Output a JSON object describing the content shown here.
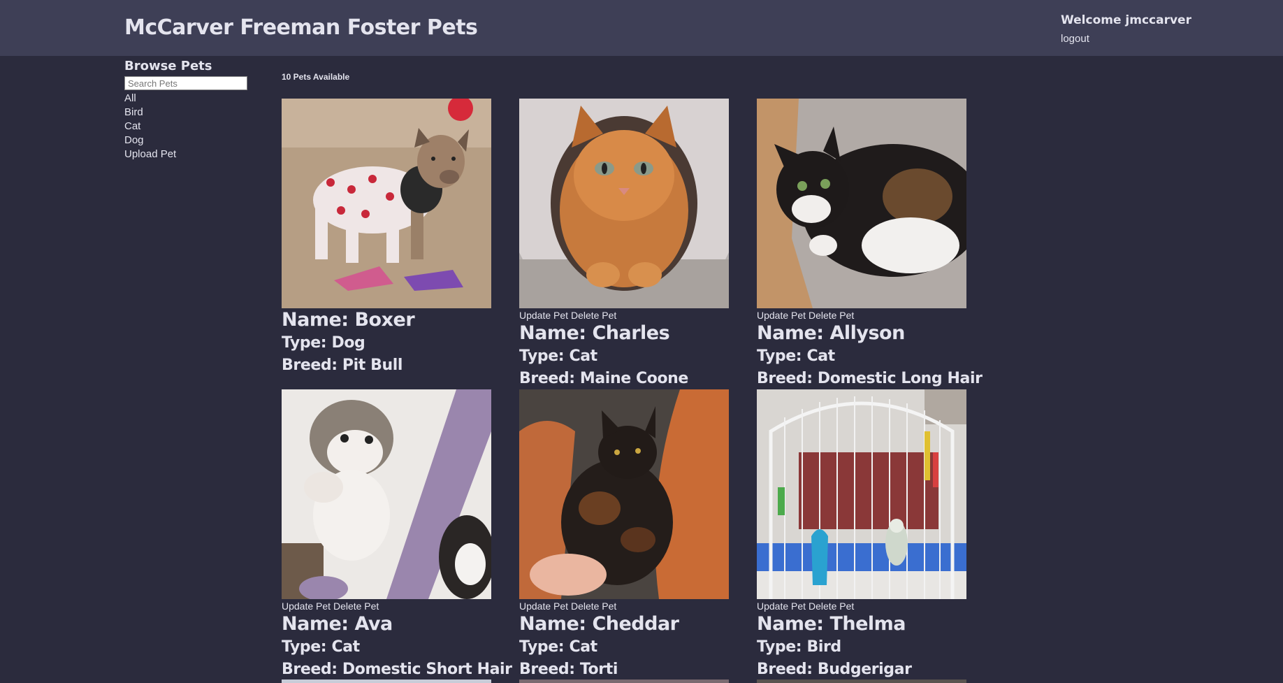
{
  "header": {
    "title": "McCarver Freeman Foster Pets",
    "welcome": "Welcome jmccarver",
    "logout": "logout"
  },
  "sidebar": {
    "heading": "Browse Pets",
    "search_placeholder": "Search Pets",
    "links": [
      "All",
      "Bird",
      "Cat",
      "Dog",
      "Upload Pet"
    ]
  },
  "main": {
    "count_text": "10 Pets Available",
    "update_label": "Update Pet",
    "delete_label": "Delete Pet",
    "pets": [
      {
        "name": "Name: Boxer",
        "type": "Type: Dog",
        "breed": "Breed: Pit Bull",
        "photo": "dog-photo",
        "show_actions": false
      },
      {
        "name": "Name: Charles",
        "type": "Type: Cat",
        "breed": "Breed: Maine Coone",
        "photo": "orange-cat-photo",
        "show_actions": true
      },
      {
        "name": "Name: Allyson",
        "type": "Type: Cat",
        "breed": "Breed: Domestic Long Hair",
        "photo": "calico-cat-photo",
        "show_actions": true
      },
      {
        "name": "Name: Ava",
        "type": "Type: Cat",
        "breed": "Breed: Domestic Short Hair",
        "photo": "kitten-photo",
        "show_actions": true
      },
      {
        "name": "Name: Cheddar",
        "type": "Type: Cat",
        "breed": "Breed: Torti",
        "photo": "tortoiseshell-cat-photo",
        "show_actions": true
      },
      {
        "name": "Name: Thelma",
        "type": "Type: Bird",
        "breed": "Breed: Budgerigar",
        "photo": "budgie-cage-photo",
        "show_actions": true
      }
    ]
  },
  "colors": {
    "background": "#2b2b3d",
    "header_bar": "#3e3f56",
    "text": "#e4e4ee"
  }
}
